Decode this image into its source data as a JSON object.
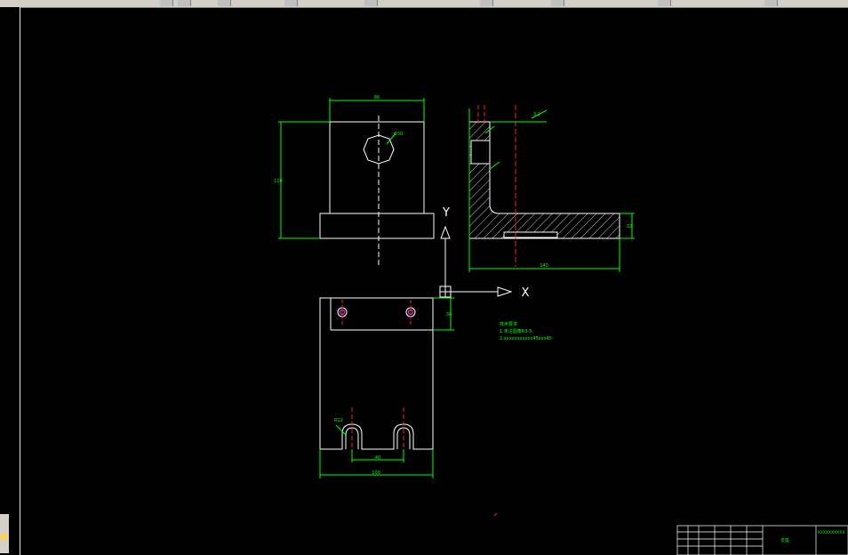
{
  "toolbar": {
    "icons": [
      "open-icon",
      "save-icon",
      "print-icon",
      "zoom-icon",
      "pan-icon",
      "layer-icon",
      "snap-icon"
    ]
  },
  "drawing": {
    "dims": {
      "top_width": "86",
      "top_height": "110",
      "hole_dia": "Φ30",
      "side_width": "140",
      "side_small": "3.2",
      "side_right": "32",
      "front_width": "100",
      "front_inner": "40",
      "front_right": "30",
      "slot_r": "R12"
    },
    "axis": {
      "x": "X",
      "y": "Y"
    },
    "notes": {
      "heading": "技术要求",
      "line1": "1.未注圆角R3-5.",
      "line2": "2.xxxxxxxxxxx45xxx45"
    },
    "title_block": {
      "label": "支座",
      "code": "XXXXXXXXXX"
    }
  }
}
